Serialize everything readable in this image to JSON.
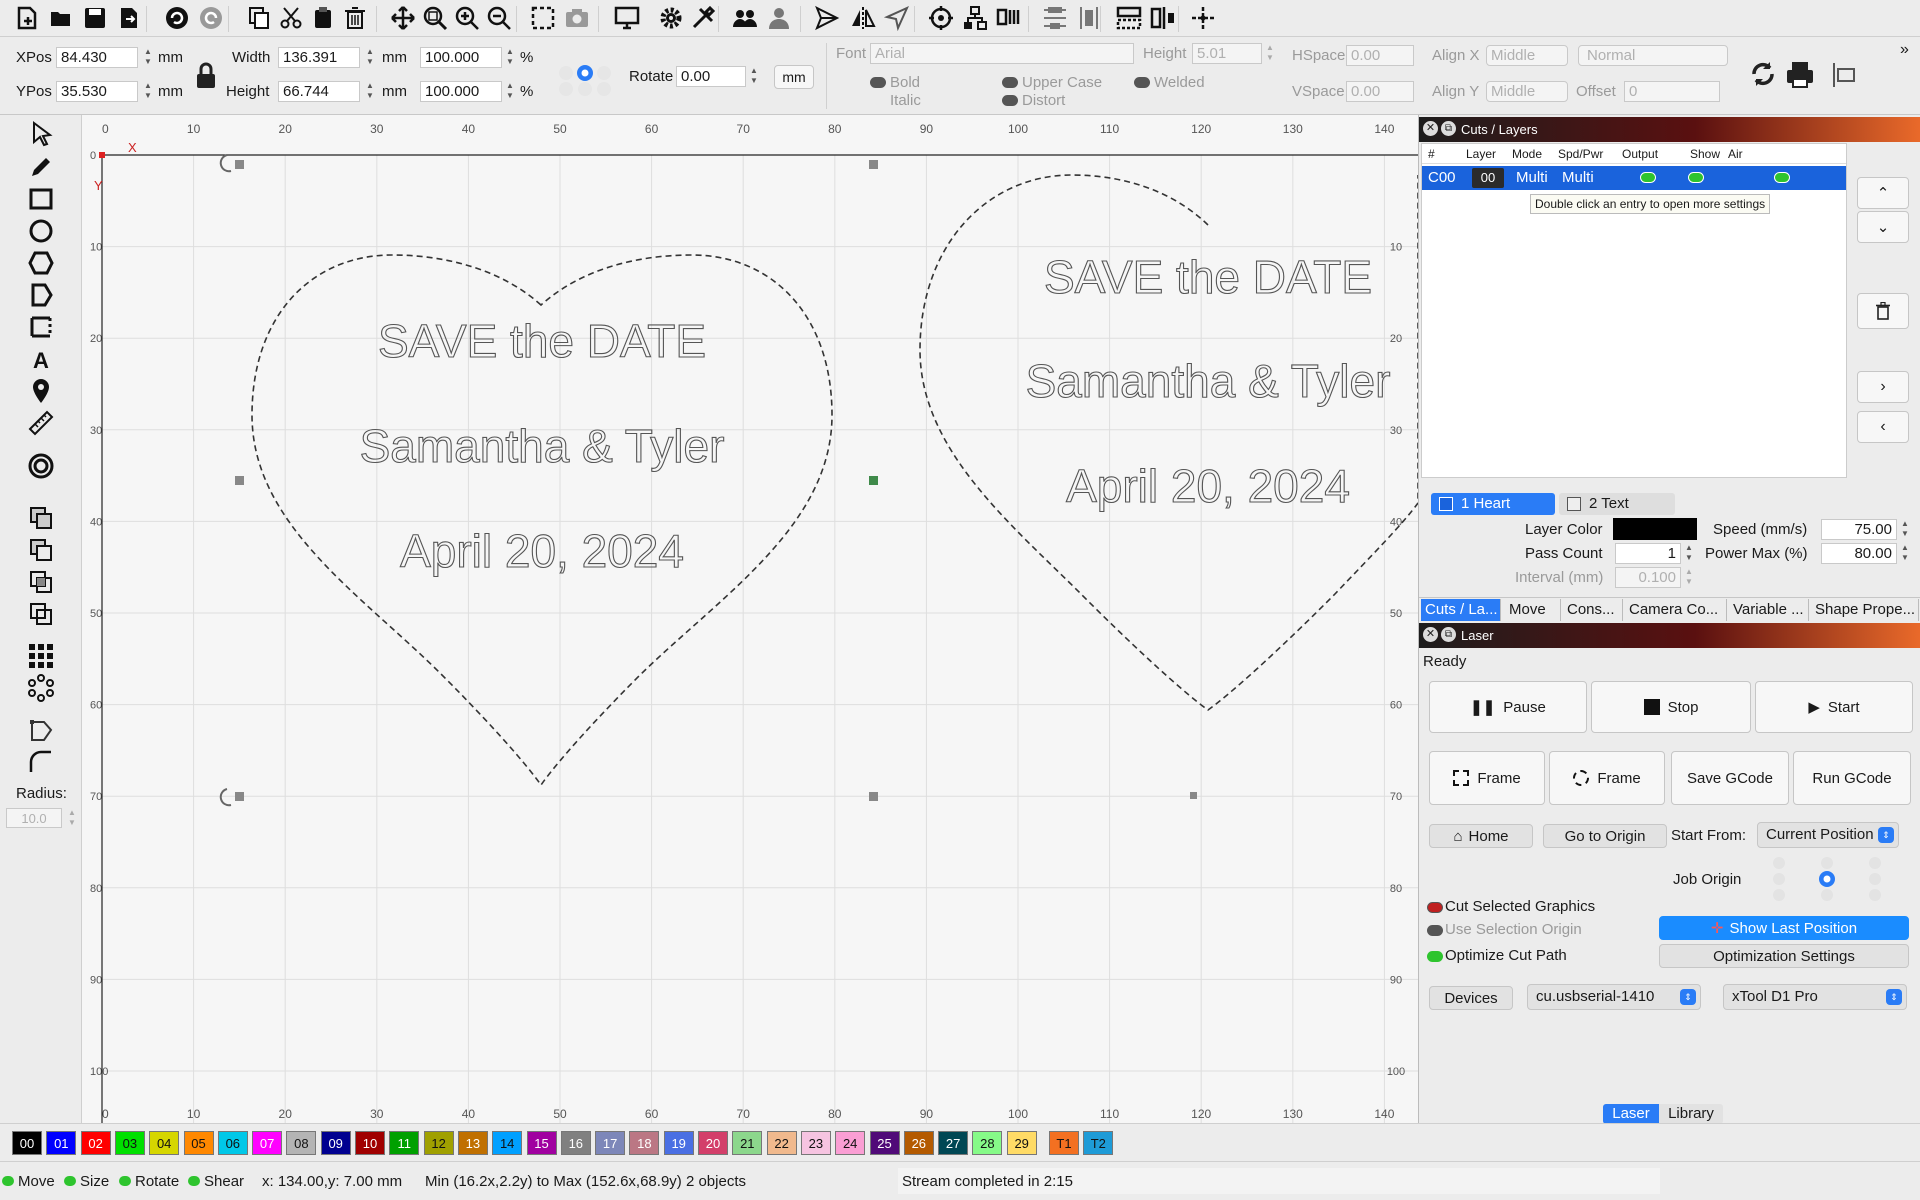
{
  "toolbar": {
    "icons": [
      "new-file-icon",
      "open-folder-icon",
      "save-icon",
      "export-icon",
      "undo-icon",
      "redo-icon",
      "copy-icon",
      "cut-icon",
      "paste-icon",
      "delete-icon",
      "move-icon",
      "zoom-fit-icon",
      "zoom-in-icon",
      "zoom-out-icon",
      "frame-selection-icon",
      "camera-icon",
      "monitor-icon",
      "settings-icon",
      "tools-icon",
      "users-icon",
      "user-icon",
      "send-icon",
      "mirror-icon",
      "send-alt-icon",
      "target-icon",
      "network-icon",
      "barcode-icon",
      "align-icon",
      "distribute-icon",
      "dock-icon",
      "split-icon",
      "crosshair-icon"
    ]
  },
  "props": {
    "xpos_label": "XPos",
    "xpos": "84.430",
    "ypos_label": "YPos",
    "ypos": "35.530",
    "unit_mm": "mm",
    "width_label": "Width",
    "width": "136.391",
    "height_label": "Height",
    "height": "66.744",
    "scale_w": "100.000",
    "scale_h": "100.000",
    "percent": "%",
    "rotate_label": "Rotate",
    "rotate": "0.00",
    "mm_button": "mm",
    "font_label": "Font",
    "font_value": "Arial",
    "font_height_label": "Height",
    "font_height": "5.01",
    "bold": "Bold",
    "italic": "Italic",
    "upper_case": "Upper Case",
    "distort": "Distort",
    "welded": "Welded",
    "hspace_label": "HSpace",
    "hspace": "0.00",
    "vspace_label": "VSpace",
    "vspace": "0.00",
    "alignx_label": "Align X",
    "alignx": "Middle",
    "aligny_label": "Align Y",
    "aligny": "Middle",
    "normal": "Normal",
    "offset_label": "Offset",
    "offset": "0"
  },
  "left_tools": {
    "icons": [
      "select-arrow-icon",
      "pencil-icon",
      "rectangle-icon",
      "circle-icon",
      "hexagon-icon",
      "polygon-icon",
      "dashed-rect-icon",
      "text-icon",
      "pin-icon",
      "ruler-icon",
      "offset-icon",
      "boolean-union-icon",
      "boolean-subtract-icon",
      "boolean-intersect-icon",
      "boolean-exclude-icon",
      "grid-array-icon",
      "circular-array-icon",
      "node-edit-icon",
      "corner-radius-icon"
    ],
    "radius_label": "Radius:",
    "radius_value": "10.0"
  },
  "canvas": {
    "x_ticks": [
      "0",
      "10",
      "20",
      "30",
      "40",
      "50",
      "60",
      "70",
      "80",
      "90",
      "100",
      "110",
      "120",
      "130",
      "140"
    ],
    "y_ticks": [
      "0",
      "10",
      "20",
      "30",
      "40",
      "50",
      "60",
      "70",
      "80",
      "90",
      "100"
    ],
    "x_axis_label": "X",
    "y_axis_label": "Y",
    "heart1": {
      "line1": "SAVE the DATE",
      "line2": "Samantha & Tyler",
      "line3": "April 20, 2024"
    },
    "heart2": {
      "line1": "SAVE the DATE",
      "line2": "Samantha & Tyler",
      "line3": "April 20, 2024"
    }
  },
  "cuts_layers": {
    "title": "Cuts / Layers",
    "headers": [
      "#",
      "Layer",
      "Mode",
      "Spd/Pwr",
      "Output",
      "Show",
      "Air"
    ],
    "row": {
      "id": "C00",
      "layer": "00",
      "mode": "Multi",
      "spdpwr": "Multi"
    },
    "tooltip": "Double click an entry to open more settings",
    "subtabs": [
      "1 Heart",
      "2 Text"
    ],
    "layer_color_label": "Layer Color",
    "pass_count_label": "Pass Count",
    "pass_count": "1",
    "interval_label": "Interval (mm)",
    "interval": "0.100",
    "speed_label": "Speed (mm/s)",
    "speed": "75.00",
    "power_label": "Power Max (%)",
    "power": "80.00",
    "layer_color": "#000000"
  },
  "panel_tabs": [
    "Cuts / La...",
    "Move",
    "Cons...",
    "Camera Co...",
    "Variable ...",
    "Shape Prope..."
  ],
  "laser": {
    "title": "Laser",
    "status": "Ready",
    "pause": "Pause",
    "stop": "Stop",
    "start": "Start",
    "frame1": "Frame",
    "frame2": "Frame",
    "save_gcode": "Save GCode",
    "run_gcode": "Run GCode",
    "home": "Home",
    "go_origin": "Go to Origin",
    "start_from_label": "Start From:",
    "start_from": "Current Position",
    "job_origin_label": "Job Origin",
    "cut_selected": "Cut Selected Graphics",
    "use_selection_origin": "Use Selection Origin",
    "optimize": "Optimize Cut Path",
    "show_last_position": "Show Last Position",
    "optimization_settings": "Optimization Settings",
    "devices": "Devices",
    "port": "cu.usbserial-1410",
    "machine": "xTool D1 Pro",
    "bottom_tabs": [
      "Laser",
      "Library"
    ]
  },
  "swatches": [
    {
      "label": "00",
      "color": "#000000"
    },
    {
      "label": "01",
      "color": "#0000ff"
    },
    {
      "label": "02",
      "color": "#ff0000"
    },
    {
      "label": "03",
      "color": "#00e000"
    },
    {
      "label": "04",
      "color": "#d6d600"
    },
    {
      "label": "05",
      "color": "#ff8800"
    },
    {
      "label": "06",
      "color": "#00c8e8"
    },
    {
      "label": "07",
      "color": "#ff00ff"
    },
    {
      "label": "08",
      "color": "#b4b4b4"
    },
    {
      "label": "09",
      "color": "#000090"
    },
    {
      "label": "10",
      "color": "#a00000"
    },
    {
      "label": "11",
      "color": "#00a000"
    },
    {
      "label": "12",
      "color": "#a0a000"
    },
    {
      "label": "13",
      "color": "#c07000"
    },
    {
      "label": "14",
      "color": "#00a0ff"
    },
    {
      "label": "15",
      "color": "#a000a0"
    },
    {
      "label": "16",
      "color": "#808080"
    },
    {
      "label": "17",
      "color": "#7d87b9"
    },
    {
      "label": "18",
      "color": "#bb7784"
    },
    {
      "label": "19",
      "color": "#4a6fe3"
    },
    {
      "label": "20",
      "color": "#d33f6a"
    },
    {
      "label": "21",
      "color": "#8cd78c"
    },
    {
      "label": "22",
      "color": "#f0b98d"
    },
    {
      "label": "23",
      "color": "#f6c4e1"
    },
    {
      "label": "24",
      "color": "#fa9ed4"
    },
    {
      "label": "25",
      "color": "#500a78"
    },
    {
      "label": "26",
      "color": "#b45a00"
    },
    {
      "label": "27",
      "color": "#004754"
    },
    {
      "label": "28",
      "color": "#86fa88"
    },
    {
      "label": "29",
      "color": "#ffdb66"
    },
    {
      "label": "T1",
      "color": "#f37021"
    },
    {
      "label": "T2",
      "color": "#1e9bd7"
    }
  ],
  "status": {
    "move": "Move",
    "size": "Size",
    "rotate": "Rotate",
    "shear": "Shear",
    "coords": "x: 134.00,y: 7.00 mm",
    "bounds": "Min (16.2x,2.2y) to Max (152.6x,68.9y)  2 objects",
    "stream": "Stream completed in 2:15"
  }
}
